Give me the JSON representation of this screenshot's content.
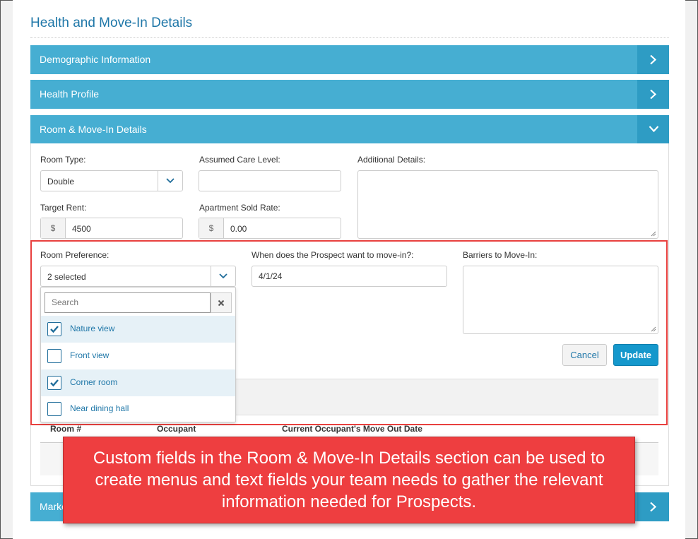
{
  "page": {
    "title": "Health and Move-In Details"
  },
  "accordion": {
    "sections": [
      {
        "label": "Demographic Information",
        "state": "collapsed"
      },
      {
        "label": "Health Profile",
        "state": "collapsed"
      },
      {
        "label": "Room & Move-In Details",
        "state": "expanded"
      },
      {
        "label": "Marke",
        "state": "collapsed"
      }
    ]
  },
  "form": {
    "room_type": {
      "label": "Room Type:",
      "value": "Double"
    },
    "care_level": {
      "label": "Assumed Care Level:",
      "value": ""
    },
    "additional_details": {
      "label": "Additional Details:",
      "value": ""
    },
    "target_rent": {
      "label": "Target Rent:",
      "currency": "$",
      "value": "4500"
    },
    "sold_rate": {
      "label": "Apartment Sold Rate:",
      "currency": "$",
      "value": "0.00"
    },
    "room_preference": {
      "label": "Room Preference:",
      "value": "2 selected"
    },
    "move_in_date": {
      "label": "When does the Prospect want to move-in?:",
      "value": "4/1/24"
    },
    "barriers": {
      "label": "Barriers to Move-In:",
      "value": ""
    }
  },
  "dropdown": {
    "search_placeholder": "Search",
    "options": [
      {
        "label": "Nature view",
        "checked": true
      },
      {
        "label": "Front view",
        "checked": false
      },
      {
        "label": "Corner room",
        "checked": true
      },
      {
        "label": "Near dining hall",
        "checked": false
      }
    ]
  },
  "actions": {
    "cancel": "Cancel",
    "update": "Update"
  },
  "table": {
    "columns": [
      "Room #",
      "Occupant",
      "Current Occupant's Move Out Date"
    ]
  },
  "callout": {
    "text": "Custom fields in the Room & Move-In Details section can be used to create menus and text fields your team needs to gather the relevant information needed for Prospects."
  },
  "colors": {
    "accordion_bar": "#46aed2",
    "accordion_toggle": "#2e9cc4",
    "highlight_border": "#e8403e",
    "callout_bg": "#ee3e40",
    "primary_button": "#1598cc"
  }
}
